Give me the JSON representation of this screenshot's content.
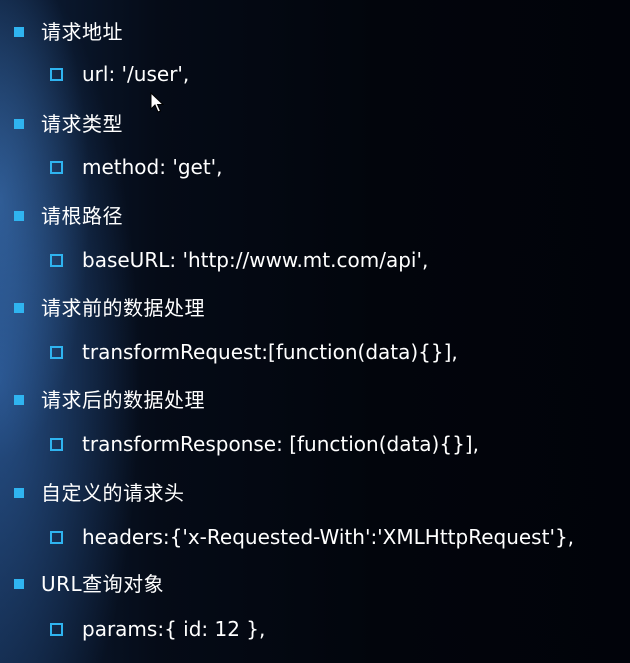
{
  "items": [
    {
      "title": "请求地址",
      "value": "url: '/user',"
    },
    {
      "title": "请求类型",
      "value": "method: 'get',"
    },
    {
      "title": "请根路径",
      "value": "baseURL: 'http://www.mt.com/api',"
    },
    {
      "title": "请求前的数据处理",
      "value": "transformRequest:[function(data){}],"
    },
    {
      "title": "请求后的数据处理",
      "value": "transformResponse: [function(data){}],"
    },
    {
      "title": "自定义的请求头",
      "value": "headers:{'x-Requested-With':'XMLHttpRequest'},"
    },
    {
      "title": "URL查询对象",
      "value": "params:{ id: 12 },"
    }
  ],
  "colors": {
    "bullet": "#2fb4f0",
    "text": "#ffffff"
  },
  "icons": {
    "level1": "filled-square-bullet-icon",
    "level2": "hollow-square-bullet-icon",
    "pointer": "mouse-cursor-icon"
  }
}
